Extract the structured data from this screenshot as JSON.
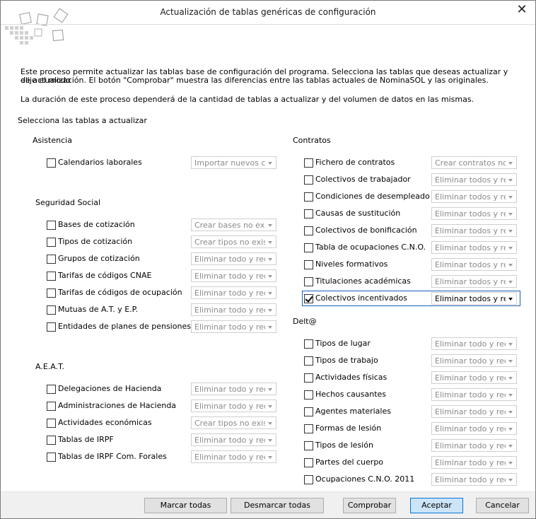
{
  "window": {
    "title": "Actualización de tablas genéricas de configuración",
    "close_glyph": "✕"
  },
  "description": {
    "line1": "Este proceso permite actualizar las tablas base de configuración del programa. Selecciona las tablas que deseas actualizar y elije el modo",
    "line2": "de actualización. El botón \"Comprobar\" muestra las diferencias entre las tablas actuales de NominaSOL y las originales.",
    "line3": "La duración de este proceso dependerá de la cantidad de tablas a actualizar y del volumen de datos en las mismas."
  },
  "section_label": "Selecciona las tablas a actualizar",
  "groups": {
    "asistencia": {
      "title": "Asistencia",
      "items": [
        {
          "label": "Calendarios laborales",
          "mode": "Importar nuevos calendarios",
          "checked": false
        }
      ]
    },
    "seguridad_social": {
      "title": "Seguridad Social",
      "items": [
        {
          "label": "Bases de cotización",
          "mode": "Crear bases no existentes",
          "checked": false
        },
        {
          "label": "Tipos de cotización",
          "mode": "Crear tipos no existentes",
          "checked": false
        },
        {
          "label": "Grupos de cotización",
          "mode": "Eliminar todo y recrear",
          "checked": false
        },
        {
          "label": "Tarifas de códigos CNAE",
          "mode": "Eliminar todo y recrear",
          "checked": false
        },
        {
          "label": "Tarifas de códigos de ocupación",
          "mode": "Eliminar todo y recrear",
          "checked": false
        },
        {
          "label": "Mutuas de A.T. y E.P.",
          "mode": "Eliminar todo y recrear",
          "checked": false
        },
        {
          "label": "Entidades de planes de pensiones",
          "mode": "Eliminar todo y recrear",
          "checked": false
        }
      ]
    },
    "aeat": {
      "title": "A.E.A.T.",
      "items": [
        {
          "label": "Delegaciones de Hacienda",
          "mode": "Eliminar todo y recrear",
          "checked": false
        },
        {
          "label": "Administraciones de Hacienda",
          "mode": "Eliminar todo y recrear",
          "checked": false
        },
        {
          "label": "Actividades económicas",
          "mode": "Crear tipos no existentes",
          "checked": false
        },
        {
          "label": "Tablas de IRPF",
          "mode": "Eliminar todo y recrear",
          "checked": false
        },
        {
          "label": "Tablas de IRPF Com. Forales",
          "mode": "Eliminar todo y recrear",
          "checked": false
        }
      ]
    },
    "contratos": {
      "title": "Contratos",
      "items": [
        {
          "label": "Fichero de contratos",
          "mode": "Crear contratos no existentes",
          "checked": false
        },
        {
          "label": "Colectivos de trabajador",
          "mode": "Eliminar todos y recrear",
          "checked": false
        },
        {
          "label": "Condiciones de desempleado",
          "mode": "Eliminar todos y recrear",
          "checked": false
        },
        {
          "label": "Causas de sustitución",
          "mode": "Eliminar todos y recrear",
          "checked": false
        },
        {
          "label": "Colectivos de bonificación",
          "mode": "Eliminar todos y recrear",
          "checked": false
        },
        {
          "label": "Tabla de ocupaciones C.N.O.",
          "mode": "Eliminar todos y recrear",
          "checked": false
        },
        {
          "label": "Niveles formativos",
          "mode": "Eliminar todos y recrear",
          "checked": false
        },
        {
          "label": "Titulaciones académicas",
          "mode": "Eliminar todos y recrear",
          "checked": false
        },
        {
          "label": "Colectivos incentivados",
          "mode": "Eliminar todos y recrear",
          "checked": true
        }
      ]
    },
    "delta": {
      "title": "Delt@",
      "items": [
        {
          "label": "Tipos de lugar",
          "mode": "Eliminar todo y recrear",
          "checked": false
        },
        {
          "label": "Tipos de trabajo",
          "mode": "Eliminar todo y recrear",
          "checked": false
        },
        {
          "label": "Actividades físicas",
          "mode": "Eliminar todo y recrear",
          "checked": false
        },
        {
          "label": "Hechos causantes",
          "mode": "Eliminar todo y recrear",
          "checked": false
        },
        {
          "label": "Agentes materiales",
          "mode": "Eliminar todo y recrear",
          "checked": false
        },
        {
          "label": "Formas de lesión",
          "mode": "Eliminar todo y recrear",
          "checked": false
        },
        {
          "label": "Tipos de lesión",
          "mode": "Eliminar todo y recrear",
          "checked": false
        },
        {
          "label": "Partes del cuerpo",
          "mode": "Eliminar todo y recrear",
          "checked": false
        },
        {
          "label": "Ocupaciones C.N.O. 2011",
          "mode": "Eliminar todo y recrear",
          "checked": false
        }
      ]
    }
  },
  "buttons": {
    "mark_all": "Marcar todas",
    "unmark_all": "Desmarcar todas",
    "check": "Comprobar",
    "accept": "Aceptar",
    "cancel": "Cancelar"
  },
  "colors": {
    "focus_border": "#1a5fb4",
    "primary_button": "#cce4f7",
    "primary_border": "#0078d7"
  }
}
